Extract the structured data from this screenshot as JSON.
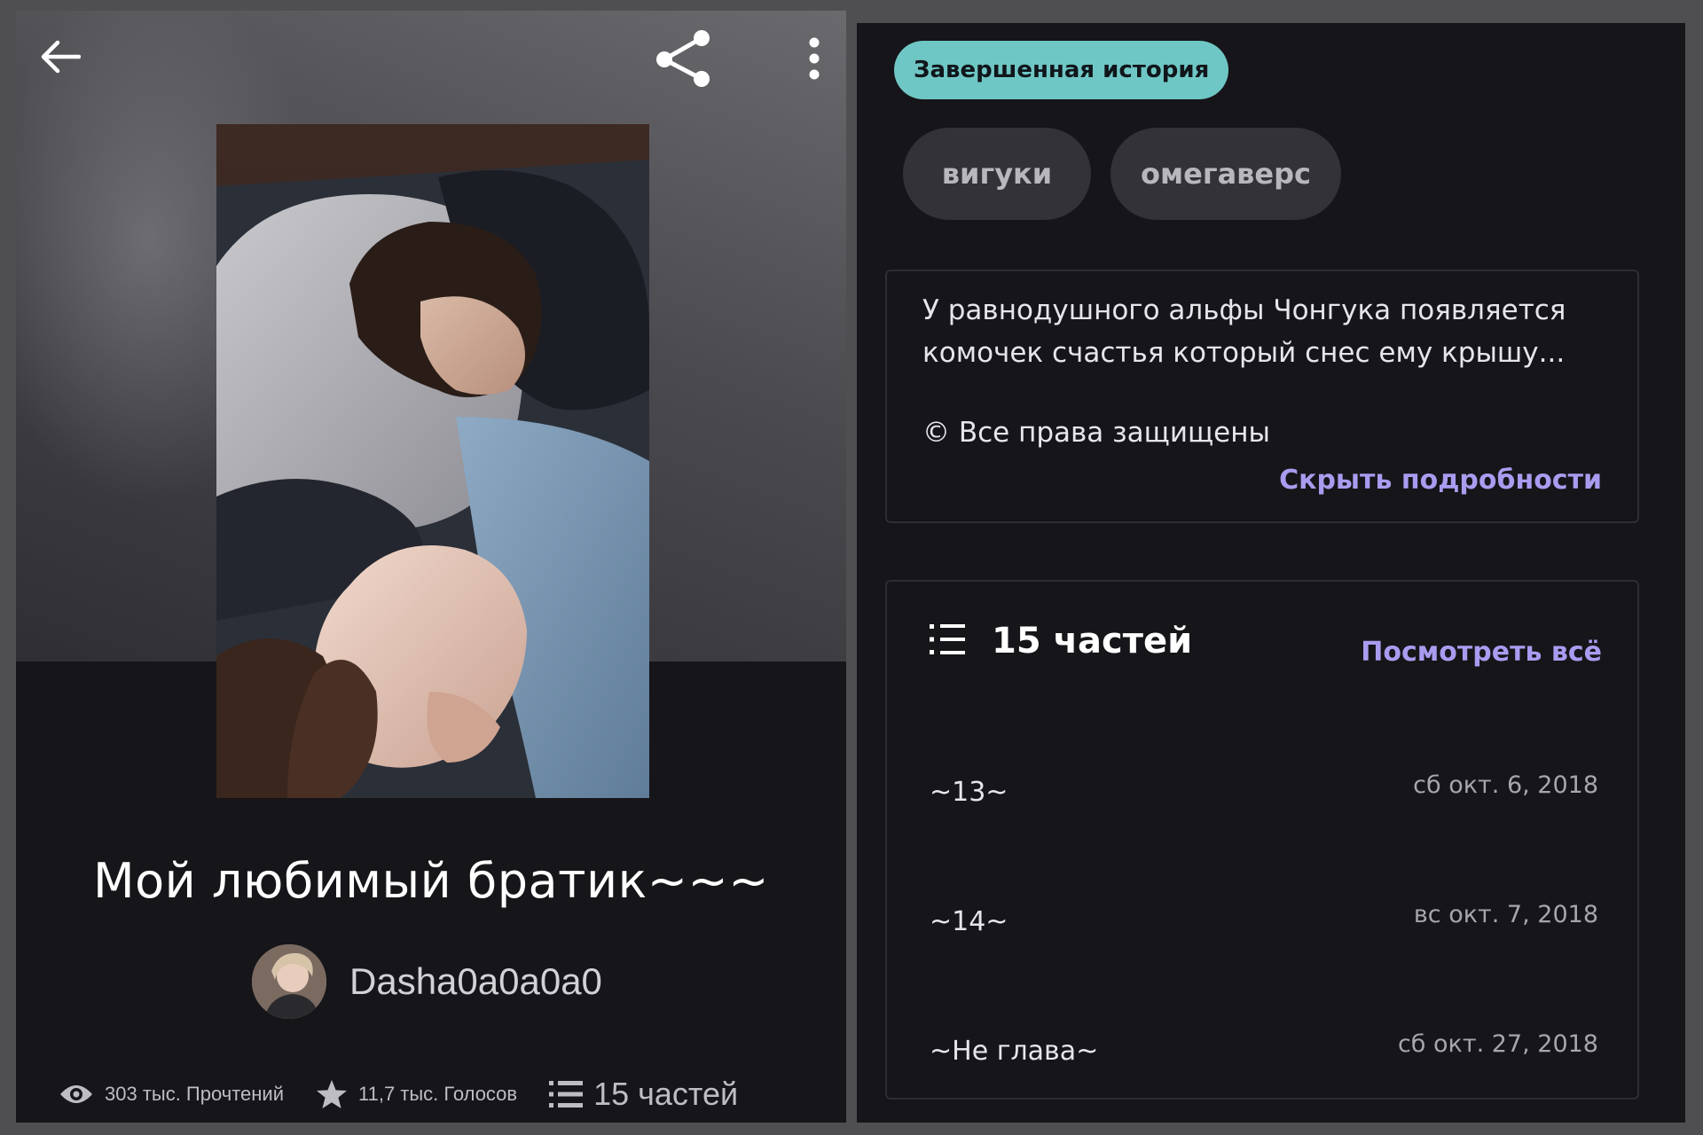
{
  "left": {
    "title": "Мой любимый братик~~~",
    "author": "Dasha0a0a0a0",
    "stats": {
      "reads": "303 тыс. Прочтений",
      "votes": "11,7 тыс. Голосов",
      "parts": "15 частей"
    },
    "icons": {
      "back": "back-arrow-icon",
      "share": "share-icon",
      "more": "more-vert-icon"
    }
  },
  "right": {
    "status": "Завершенная история",
    "tags": [
      "вигуки",
      "омегаверс"
    ],
    "description": "У равнодушного альфы Чонгука появляется комочек счастья который снес ему крышу...",
    "copyright": "© Все права защищены",
    "hide_details": "Скрыть подробности",
    "parts_title": "15 частей",
    "view_all": "Посмотреть всё",
    "parts": [
      {
        "name": "~13~",
        "date": "сб окт. 6, 2018"
      },
      {
        "name": "~14~",
        "date": "вс окт. 7, 2018"
      },
      {
        "name": "~Не глава~",
        "date": "сб окт. 27, 2018"
      }
    ]
  },
  "colors": {
    "background": "#161519",
    "badge": "#6fc7c5",
    "link": "#a99cf0",
    "tag": "#333236"
  }
}
